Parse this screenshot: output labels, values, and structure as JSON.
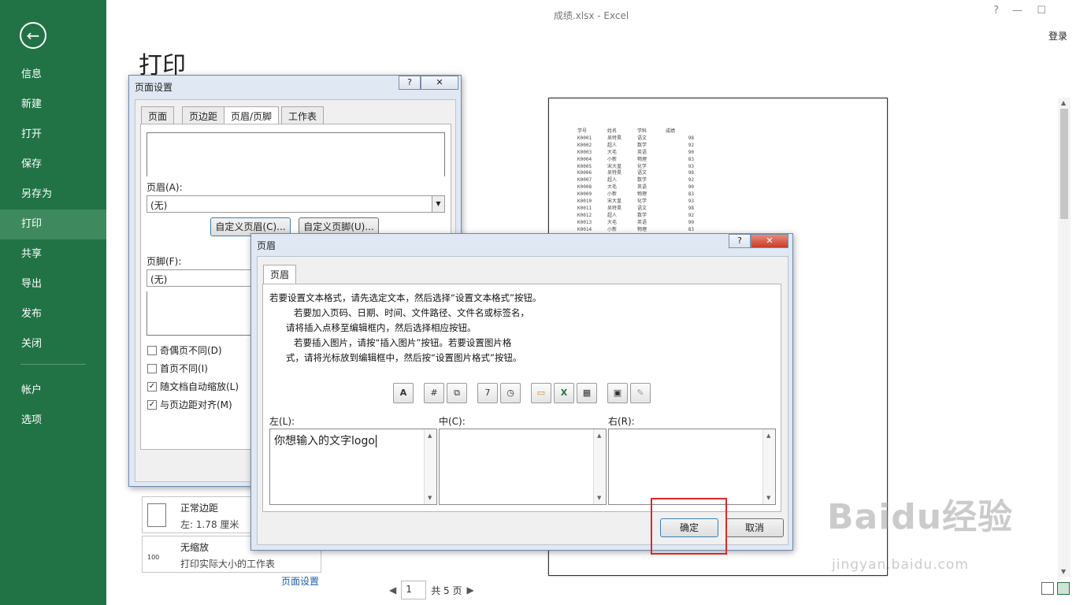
{
  "window": {
    "title": "成绩.xlsx - Excel",
    "help": "?",
    "minimize": "—",
    "maximize": "☐",
    "login": "登录"
  },
  "sidebar": {
    "back_icon": "←",
    "items": [
      {
        "label": "信息"
      },
      {
        "label": "新建"
      },
      {
        "label": "打开"
      },
      {
        "label": "保存"
      },
      {
        "label": "另存为"
      },
      {
        "label": "打印"
      },
      {
        "label": "共享"
      },
      {
        "label": "导出"
      },
      {
        "label": "发布"
      },
      {
        "label": "关闭"
      }
    ],
    "items2": [
      {
        "label": "帐户"
      },
      {
        "label": "选项"
      }
    ]
  },
  "print": {
    "heading": "打印",
    "settings": [
      {
        "title": "正常边距",
        "detail": "左: 1.78 厘米"
      },
      {
        "title": "无缩放",
        "detail": "打印实际大小的工作表"
      }
    ],
    "page_setup_link": "页面设置",
    "pager": {
      "current": "1",
      "total": "共 5 页"
    }
  },
  "preview": {
    "headers": [
      "学号",
      "姓名",
      "学科",
      "成绩"
    ],
    "rows": [
      [
        "K0001",
        "吴特昊",
        "语文",
        "98"
      ],
      [
        "K0002",
        "超人",
        "数学",
        "92"
      ],
      [
        "K0003",
        "大毛",
        "英语",
        "90"
      ],
      [
        "K0004",
        "小新",
        "物理",
        "83"
      ],
      [
        "K0005",
        "宋大皇",
        "化学",
        "93"
      ],
      [
        "K0006",
        "吴特昊",
        "语文",
        "98"
      ],
      [
        "K0007",
        "超人",
        "数学",
        "92"
      ],
      [
        "K0008",
        "大毛",
        "英语",
        "90"
      ],
      [
        "K0009",
        "小新",
        "物理",
        "83"
      ],
      [
        "K0010",
        "宋大皇",
        "化学",
        "93"
      ],
      [
        "K0011",
        "吴特昊",
        "语文",
        "98"
      ],
      [
        "K0012",
        "超人",
        "数学",
        "92"
      ],
      [
        "K0013",
        "大毛",
        "英语",
        "90"
      ],
      [
        "K0014",
        "小新",
        "物理",
        "83"
      ]
    ]
  },
  "page_setup_dialog": {
    "title": "页面设置",
    "help": "?",
    "close": "✕",
    "tabs": [
      "页面",
      "页边距",
      "页眉/页脚",
      "工作表"
    ],
    "header_label": "页眉(A):",
    "header_value": "(无)",
    "custom_header_btn": "自定义页眉(C)...",
    "custom_footer_btn": "自定义页脚(U)...",
    "footer_label": "页脚(F):",
    "footer_value": "(无)",
    "checkboxes": [
      {
        "label": "奇偶页不同(D)",
        "checked": false
      },
      {
        "label": "首页不同(I)",
        "checked": false
      },
      {
        "label": "随文档自动缩放(L)",
        "checked": true
      },
      {
        "label": "与页边距对齐(M)",
        "checked": true
      }
    ]
  },
  "header_dialog": {
    "title": "页眉",
    "help": "?",
    "close": "✕",
    "tab": "页眉",
    "instructions": [
      "若要设置文本格式，请先选定文本，然后选择“设置文本格式”按钮。",
      "若要加入页码、日期、时间、文件路径、文件名或标签名，",
      "请将插入点移至编辑框内，然后选择相应按钮。",
      "若要插入图片，请按“插入图片”按钮。若要设置图片格",
      "式，请将光标放到编辑框中，然后按“设置图片格式”按钮。"
    ],
    "toolbar": [
      {
        "icon": "format-text-icon",
        "glyph": "A"
      },
      {
        "icon": "insert-page-number-icon",
        "glyph": "#"
      },
      {
        "icon": "insert-page-count-icon",
        "glyph": "⧉"
      },
      {
        "icon": "insert-date-icon",
        "glyph": "7"
      },
      {
        "icon": "insert-time-icon",
        "glyph": "◷"
      },
      {
        "icon": "insert-file-path-icon",
        "glyph": "▭"
      },
      {
        "icon": "insert-file-name-icon",
        "glyph": "X"
      },
      {
        "icon": "insert-sheet-name-icon",
        "glyph": "▦"
      },
      {
        "icon": "insert-picture-icon",
        "glyph": "▣"
      },
      {
        "icon": "format-picture-icon",
        "glyph": "✎"
      }
    ],
    "left_label": "左(L):",
    "center_label": "中(C):",
    "right_label": "右(R):",
    "left_value": "你想输入的文字logo",
    "center_value": "",
    "right_value": "",
    "ok": "确定",
    "cancel": "取消"
  },
  "watermark": {
    "brand": "Baidu经验",
    "url": "jingyan.baidu.com"
  },
  "colors": {
    "excel_green": "#217346",
    "highlight_red": "#e0262b"
  }
}
